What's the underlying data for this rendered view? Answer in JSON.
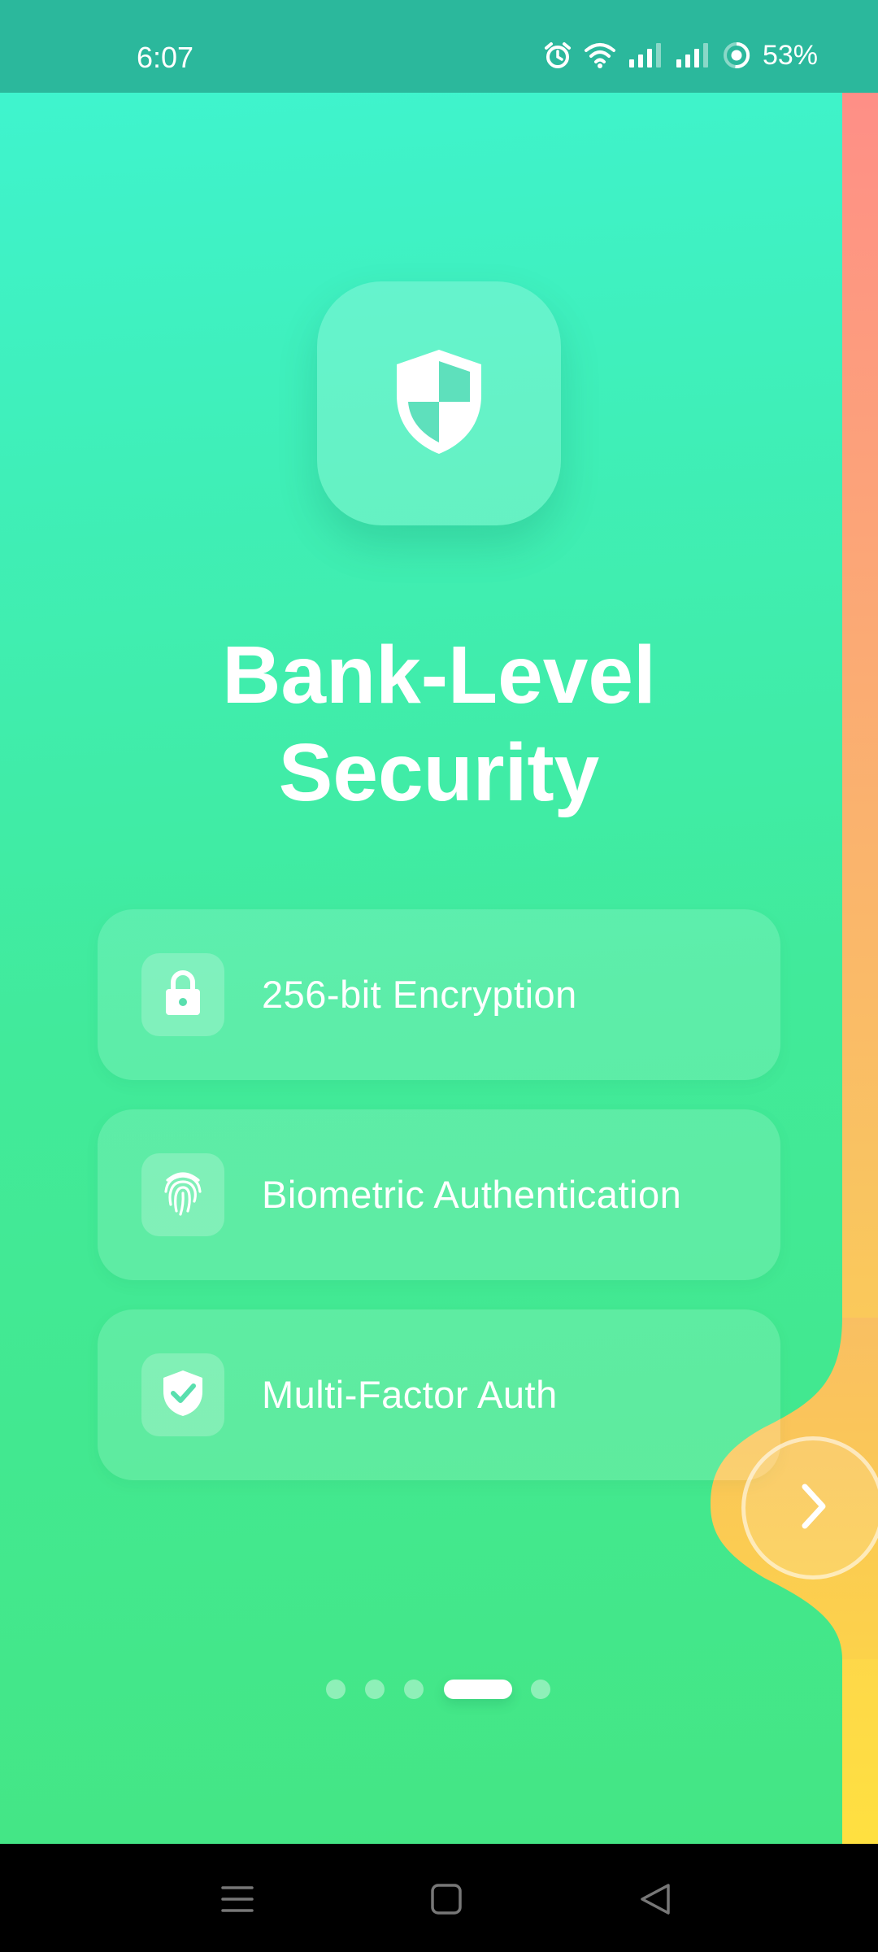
{
  "status_bar": {
    "time": "6:07",
    "battery": "53%",
    "icons": [
      "alarm-icon",
      "wifi-icon",
      "signal-icon",
      "signal-icon",
      "battery-ring-icon"
    ]
  },
  "hero": {
    "icon": "shield-icon",
    "title_line1": "Bank-Level",
    "title_line2": "Security"
  },
  "features": [
    {
      "icon": "lock-icon",
      "label": "256-bit Encryption"
    },
    {
      "icon": "fingerprint-icon",
      "label": "Biometric Authentication"
    },
    {
      "icon": "shield-check-icon",
      "label": "Multi-Factor Auth"
    }
  ],
  "pagination": {
    "total": 5,
    "current_index": 3
  },
  "next_button": {
    "icon": "chevron-right-icon"
  },
  "nav_bar": {
    "icons": [
      "menu-icon",
      "home-icon",
      "back-icon"
    ]
  },
  "colors": {
    "gradient_top": "#3ff5d3",
    "gradient_bottom": "#44e684",
    "accent_strip_top": "#ff8a8a",
    "accent_strip_bottom": "#ffe040",
    "status_bar": "#2bb89c"
  }
}
